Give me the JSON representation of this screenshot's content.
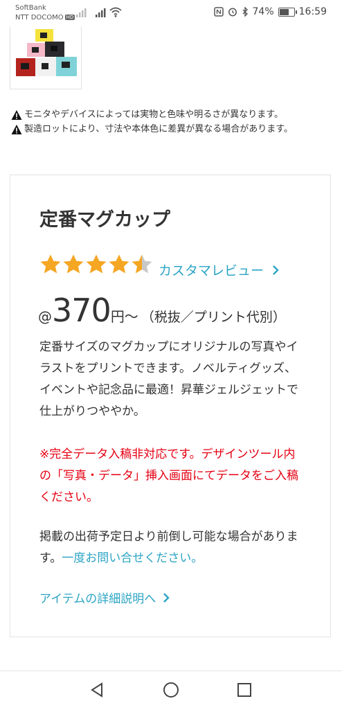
{
  "status_bar": {
    "carrier_primary": "SoftBank",
    "carrier_secondary": "NTT DOCOMO",
    "hd_badge": "HD",
    "battery_percent": "74%",
    "battery_level": 0.74,
    "time": "16:59"
  },
  "notes": [
    "モニタやデバイスによっては実物と色味や明るさが異なります。",
    "製造ロットにより、寸法や本体色に差異が異なる場合があります。"
  ],
  "product": {
    "title": "定番マグカップ",
    "rating": 4.5,
    "rating_max": 5,
    "review_link": "カスタマレビュー",
    "price_prefix": "@",
    "price": "370",
    "price_unit": "円〜",
    "price_note": "（税抜／プリント代別）",
    "description": "定番サイズのマグカップにオリジナルの写真やイラストをプリントできます。ノベルティグッズ、イベントや記念品に最適！昇華ジェルジェットで仕上がりつややか。",
    "warning": "※完全データ入稿非対応です。デザインツール内の「写真・データ」挿入画面にてデータをご入稿ください。",
    "shipping_note": "掲載の出荷予定日より前倒し可能な場合があります。",
    "contact_link": "一度お問い合せください。",
    "detail_link": "アイテムの詳細説明へ"
  },
  "colors": {
    "accent_link": "#2ba4c4",
    "warning_red": "#e50012",
    "star_gold": "#f5a623",
    "star_empty": "#c8c8c8"
  },
  "icons": [
    "signal-icon",
    "wifi-icon",
    "nfc-icon",
    "alarm-icon",
    "bluetooth-icon",
    "battery-icon",
    "warning-icon",
    "star-icon",
    "chevron-right-icon",
    "back-icon",
    "home-icon",
    "recents-icon"
  ]
}
